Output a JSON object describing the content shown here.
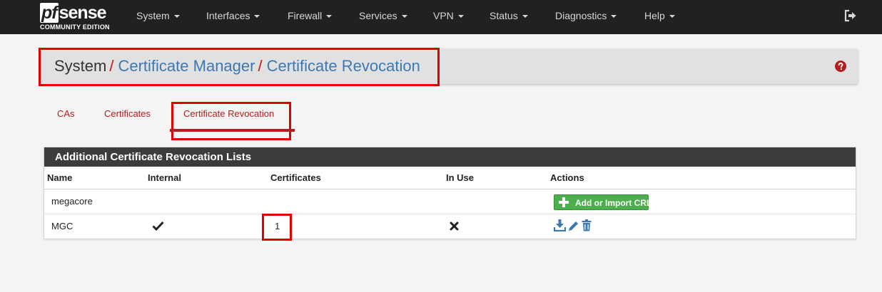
{
  "brand": {
    "logo_pf": "pf",
    "logo_sense": "sense",
    "edition": "COMMUNITY EDITION"
  },
  "nav": {
    "items": [
      "System",
      "Interfaces",
      "Firewall",
      "Services",
      "VPN",
      "Status",
      "Diagnostics",
      "Help"
    ]
  },
  "breadcrumb": {
    "root": "System",
    "separator": "/",
    "level1": "Certificate Manager",
    "level2": "Certificate Revocation"
  },
  "tabs": [
    {
      "label": "CAs",
      "active": false
    },
    {
      "label": "Certificates",
      "active": false
    },
    {
      "label": "Certificate Revocation",
      "active": true
    }
  ],
  "panel": {
    "title": "Additional Certificate Revocation Lists",
    "columns": [
      "Name",
      "Internal",
      "Certificates",
      "In Use",
      "Actions"
    ],
    "groups": [
      {
        "name": "megacore",
        "action_button": "Add or Import CRL"
      }
    ],
    "rows": [
      {
        "name": "MGC",
        "internal": "check-icon",
        "certificates": "1",
        "in_use": "x-icon",
        "actions": [
          "download-icon",
          "edit-icon",
          "delete-icon"
        ]
      }
    ]
  },
  "colors": {
    "navbar": "#212121",
    "link_blue": "#3d78b5",
    "accent_red": "#b71c1c",
    "success_green": "#4cae4c",
    "annotation_red": "#e00000"
  }
}
